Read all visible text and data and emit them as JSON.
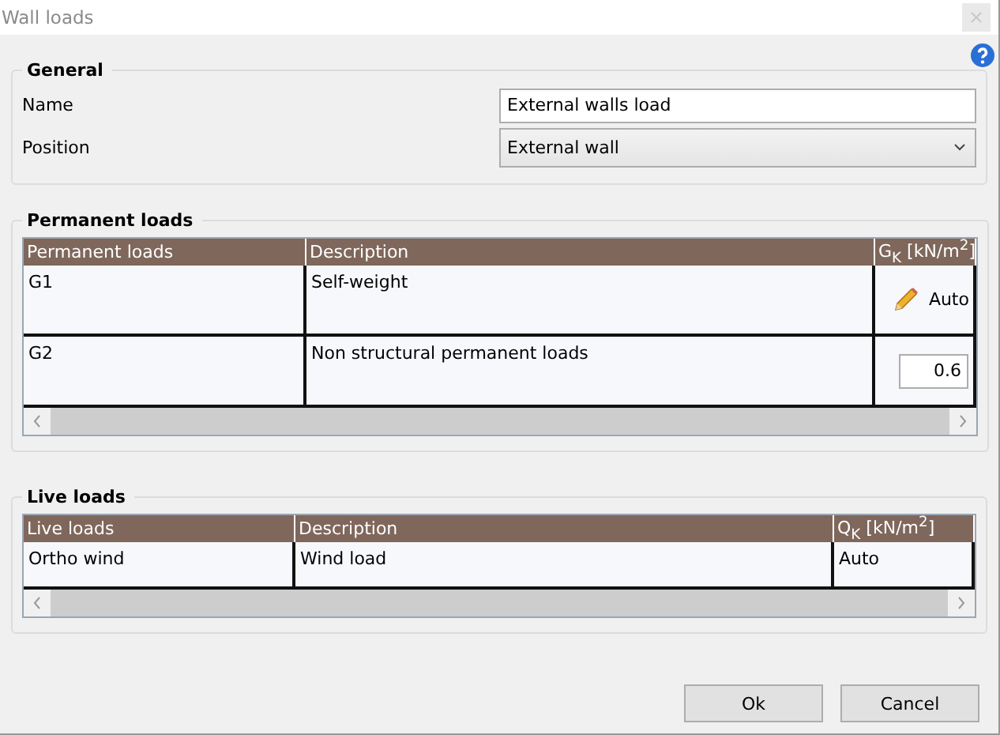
{
  "window": {
    "title": "Wall loads"
  },
  "general": {
    "title": "General",
    "fields": [
      {
        "kind": "input",
        "label": "Name",
        "value": "External walls load"
      },
      {
        "kind": "select",
        "label": "Position",
        "value": "External wall"
      }
    ]
  },
  "permanent_loads": {
    "title": "Permanent loads",
    "table": {
      "columns": [
        "Permanent loads",
        "Description",
        "G$_{K}$ [kN/m$^{2}$]"
      ],
      "rows": [
        {
          "cells": [
            {
              "kind": "text",
              "text": "G1"
            },
            {
              "kind": "text",
              "text": "Self-weight"
            },
            {
              "kind": "auto",
              "text": "Auto"
            }
          ]
        },
        {
          "cells": [
            {
              "kind": "text",
              "text": "G2"
            },
            {
              "kind": "text",
              "text": "Non structural permanent loads"
            },
            {
              "kind": "input",
              "text": "0.6"
            }
          ]
        }
      ]
    }
  },
  "live_loads": {
    "title": "Live loads",
    "table": {
      "columns": [
        "Live loads",
        "Description",
        "Q$_{K}$ [kN/m$^{2}$]"
      ],
      "rows": [
        {
          "cells": [
            {
              "kind": "text",
              "text": "Ortho wind"
            },
            {
              "kind": "text",
              "text": "Wind load"
            },
            {
              "kind": "text",
              "text": "Auto"
            }
          ]
        }
      ]
    }
  },
  "buttons": [
    "Ok",
    "Cancel"
  ]
}
